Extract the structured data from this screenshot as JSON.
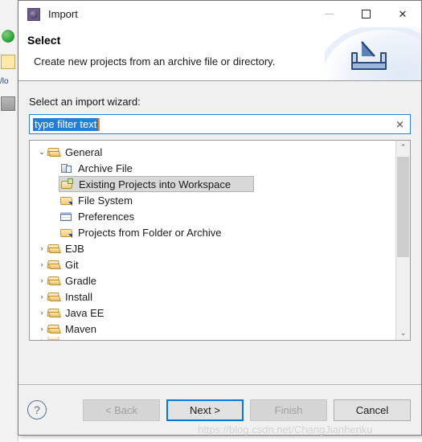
{
  "window": {
    "title": "Import",
    "app_icon": "eclipse-gear-icon",
    "minimize_label": "—",
    "maximize_label": "□",
    "close_label": "✕"
  },
  "header": {
    "title": "Select",
    "description": "Create new projects from an archive file or directory.",
    "banner_icon": "import-tray-arrow-icon"
  },
  "form": {
    "field_label": "Select an import wizard:",
    "filter": {
      "value": "type filter text",
      "placeholder": "type filter text",
      "selected": true,
      "clear_label": "✕"
    }
  },
  "tree": {
    "items": [
      {
        "label": "General",
        "level": 0,
        "icon": "folder-open",
        "twisty": "⌄",
        "expanded": true,
        "selected": false
      },
      {
        "label": "Archive File",
        "level": 1,
        "icon": "archive",
        "twisty": "",
        "expanded": false,
        "selected": false
      },
      {
        "label": "Existing Projects into Workspace",
        "level": 1,
        "icon": "proj-import",
        "twisty": "",
        "expanded": false,
        "selected": true
      },
      {
        "label": "File System",
        "level": 1,
        "icon": "folder-arrow",
        "twisty": "",
        "expanded": false,
        "selected": false
      },
      {
        "label": "Preferences",
        "level": 1,
        "icon": "prefs",
        "twisty": "",
        "expanded": false,
        "selected": false
      },
      {
        "label": "Projects from Folder or Archive",
        "level": 1,
        "icon": "folder-arrow",
        "twisty": "",
        "expanded": false,
        "selected": false
      },
      {
        "label": "EJB",
        "level": 0,
        "icon": "folder-open",
        "twisty": "›",
        "expanded": false,
        "selected": false
      },
      {
        "label": "Git",
        "level": 0,
        "icon": "folder-open",
        "twisty": "›",
        "expanded": false,
        "selected": false
      },
      {
        "label": "Gradle",
        "level": 0,
        "icon": "folder-open",
        "twisty": "›",
        "expanded": false,
        "selected": false
      },
      {
        "label": "Install",
        "level": 0,
        "icon": "folder-open",
        "twisty": "›",
        "expanded": false,
        "selected": false
      },
      {
        "label": "Java EE",
        "level": 0,
        "icon": "folder-open",
        "twisty": "›",
        "expanded": false,
        "selected": false
      },
      {
        "label": "Maven",
        "level": 0,
        "icon": "folder-open",
        "twisty": "›",
        "expanded": false,
        "selected": false
      }
    ],
    "scrollbar": {
      "up_arrow": "⌃",
      "down_arrow": "⌄"
    }
  },
  "footer": {
    "help_label": "?",
    "buttons": [
      {
        "label": "< Back",
        "state": "disabled"
      },
      {
        "label": "Next >",
        "state": "default"
      },
      {
        "label": "Finish",
        "state": "disabled"
      },
      {
        "label": "Cancel",
        "state": "normal"
      }
    ]
  },
  "watermark": {
    "text": "https://blog.csdn.net/ChangJianhenku"
  },
  "colors": {
    "accent": "#0078d7",
    "selection": "#1f7fd9",
    "dialog_bg": "#f0f0f0",
    "header_bg": "#ffffff",
    "tree_selection": "#d8d8d8"
  }
}
